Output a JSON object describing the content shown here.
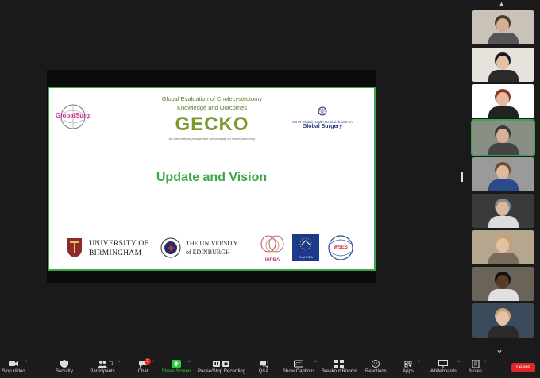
{
  "slide": {
    "head_line1": "Global Evaluation of Cholecystectomy",
    "head_line2": "Knowledge and Outcomes",
    "logo": "GECKO",
    "tagline": "An international prospective cohort study on cholecystectomy",
    "globalsurg": "GlobalSurg",
    "nihr_small": "NIHR Global Health Research Unit on",
    "nihr_big": "Global Surgery",
    "title": "Update and Vision",
    "uob_line1": "UNIVERSITY OF",
    "uob_line2": "BIRMINGHAM",
    "uoe_line1": "THE UNIVERSITY",
    "uoe_line2": "of EDINBURGH",
    "ihpba": "IHPBA",
    "eahpba": "E-AHPBA",
    "wses": "WSES"
  },
  "participants": [
    {
      "skin": "#d1b096",
      "hair": "#4a3a2a",
      "shirt": "#555",
      "bg": "#c9c2b8"
    },
    {
      "skin": "#e2c2a6",
      "hair": "#1a1a1a",
      "shirt": "#2a2a2a",
      "bg": "#e6e2dc"
    },
    {
      "skin": "#e7b9a3",
      "hair": "#8a3a1a",
      "shirt": "#222",
      "bg": "#ffffff"
    },
    {
      "skin": "#d6b199",
      "hair": "#3a3a3a",
      "shirt": "#444",
      "bg": "#8a8f86"
    },
    {
      "skin": "#e0b8a0",
      "hair": "#6a5030",
      "shirt": "#2a4a8a",
      "bg": "#9a9a9a"
    },
    {
      "skin": "#d8b8a0",
      "hair": "#8a8a8a",
      "shirt": "#dcdcdc",
      "bg": "#3a3a3a"
    },
    {
      "skin": "#e2c0a4",
      "hair": "#c9a46a",
      "shirt": "#7a6a5a",
      "bg": "#b5a68e"
    },
    {
      "skin": "#5a3a24",
      "hair": "#111",
      "shirt": "#e0e0e0",
      "bg": "#6a6458"
    },
    {
      "skin": "#e6c2a8",
      "hair": "#caa36a",
      "shirt": "#2a2a2a",
      "bg": "#3a4a5a"
    }
  ],
  "toolbar": {
    "stop_video": "Stop Video",
    "security": "Security",
    "participants": "Participants",
    "participants_count": "71",
    "chat": "Chat",
    "chat_badge": "2",
    "share_screen": "Share Screen",
    "record": "Pause/Stop Recording",
    "qa": "Q&A",
    "captions": "Show Captions",
    "breakout": "Breakout Rooms",
    "reactions": "Reactions",
    "apps": "Apps",
    "whiteboards": "Whiteboards",
    "notes": "Notes",
    "leave": "Leave"
  },
  "colors": {
    "accent_green": "#3fa54a",
    "leave_red": "#e02828"
  }
}
